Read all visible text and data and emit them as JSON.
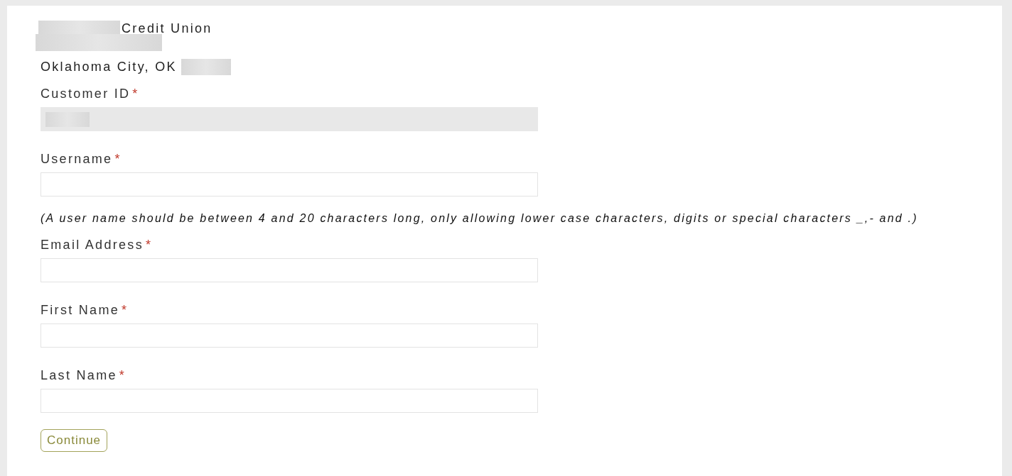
{
  "header": {
    "name_suffix": "Credit Union",
    "city_line": "Oklahoma City, OK"
  },
  "fields": [
    {
      "label": "Customer ID",
      "required": true,
      "disabled": true
    },
    {
      "label": "Username",
      "required": true,
      "disabled": false,
      "hint": "(A user name should be between 4 and 20 characters long, only allowing lower case characters, digits or special characters _,- and .)"
    },
    {
      "label": "Email Address",
      "required": true,
      "disabled": false
    },
    {
      "label": "First Name",
      "required": true,
      "disabled": false
    },
    {
      "label": "Last Name",
      "required": true,
      "disabled": false
    }
  ],
  "required_mark": "*",
  "submit": {
    "label": "Continue"
  }
}
